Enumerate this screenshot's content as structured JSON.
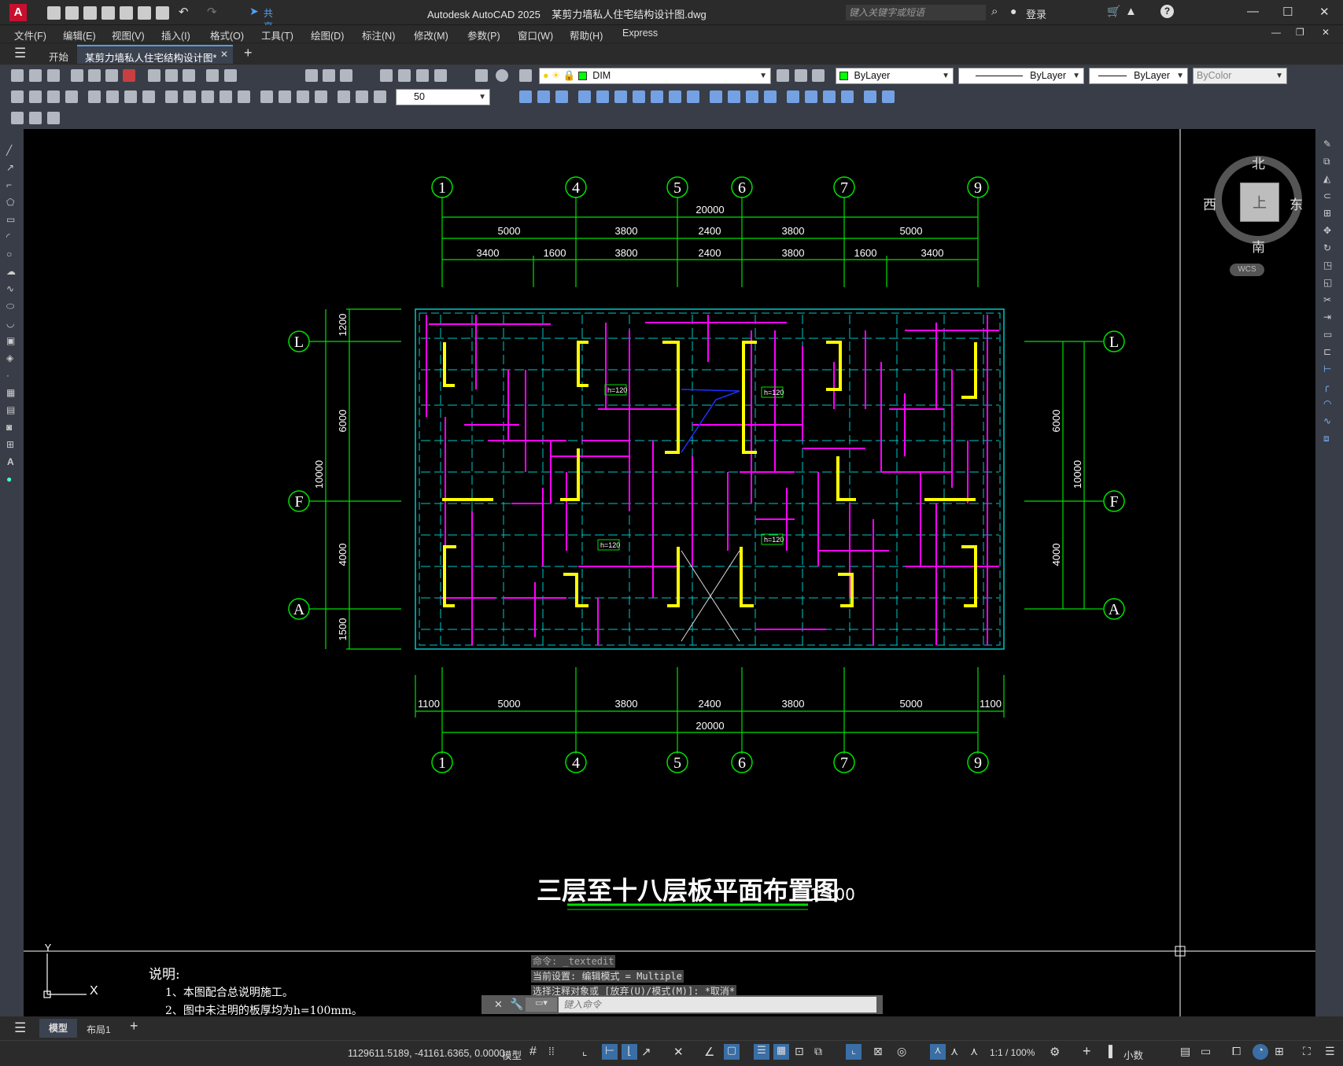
{
  "title_bar": {
    "title": "Autodesk AutoCAD 2025    某剪力墙私人住宅结构设计图.dwg",
    "share_label": "共享",
    "search_placeholder": "键入关键字或短语",
    "signin_label": "登录"
  },
  "menu": [
    "文件(F)",
    "编辑(E)",
    "视图(V)",
    "插入(I)",
    "格式(O)",
    "工具(T)",
    "绘图(D)",
    "标注(N)",
    "修改(M)",
    "参数(P)",
    "窗口(W)",
    "帮助(H)",
    "Express"
  ],
  "tabs": {
    "start": "开始",
    "active": "某剪力墙私人住宅结构设计图*"
  },
  "toolbar": {
    "layer": "DIM",
    "color": "ByLayer",
    "linetype": "ByLayer",
    "lineweight": "ByLayer",
    "plotstyle": "ByColor",
    "dimscale": "50"
  },
  "viewcube": {
    "north": "北",
    "south": "南",
    "east": "东",
    "west": "西",
    "face": "上",
    "wcs": "WCS"
  },
  "drawing": {
    "axes_top": [
      "1",
      "4",
      "5",
      "6",
      "7",
      "9"
    ],
    "axes_side": [
      "L",
      "F",
      "A"
    ],
    "top_total": "20000",
    "top_row1": [
      "5000",
      "3800",
      "2400",
      "3800",
      "5000"
    ],
    "top_row2": [
      "3400",
      "1600",
      "3800",
      "2400",
      "3800",
      "1600",
      "3400"
    ],
    "bottom_row1": [
      "1100",
      "5000",
      "3800",
      "2400",
      "3800",
      "5000",
      "1100"
    ],
    "bottom_total": "20000",
    "left_dims": [
      "1200",
      "6000",
      "4000",
      "1500"
    ],
    "left_total": "10000",
    "right_dims": [
      "6000",
      "4000"
    ],
    "right_total": "10000",
    "plan_title": "三层至十八层板平面布置图",
    "plan_scale": "1:100",
    "slab_labels": [
      "h=120",
      "h=120",
      "h=120",
      "h=120"
    ],
    "notes_title": "说明:",
    "notes": [
      "1、本图配合总说明施工。",
      "2、图中未注明的板厚均为h=100mm。"
    ],
    "ucs_x": "X",
    "ucs_y": "Y"
  },
  "command": {
    "lines": [
      "命令: _textedit",
      "当前设置: 编辑模式 = Multiple",
      "选择注释对象或 [放弃(U)/模式(M)]: *取消*"
    ],
    "placeholder": "键入命令"
  },
  "layout_tabs": [
    "模型",
    "布局1"
  ],
  "status": {
    "coords": "1129611.5189, -41161.6365, 0.0000",
    "model": "模型",
    "scale": "1:1 / 100%",
    "units": "小数"
  },
  "colors": {
    "background": "#000000",
    "axis_green": "#00e000",
    "wall_yellow": "#ffff00",
    "beam_magenta": "#ff00ff",
    "grid_cyan": "#00c8c8",
    "ui_dark": "#2b2b2b",
    "toolbar": "#383d47"
  }
}
